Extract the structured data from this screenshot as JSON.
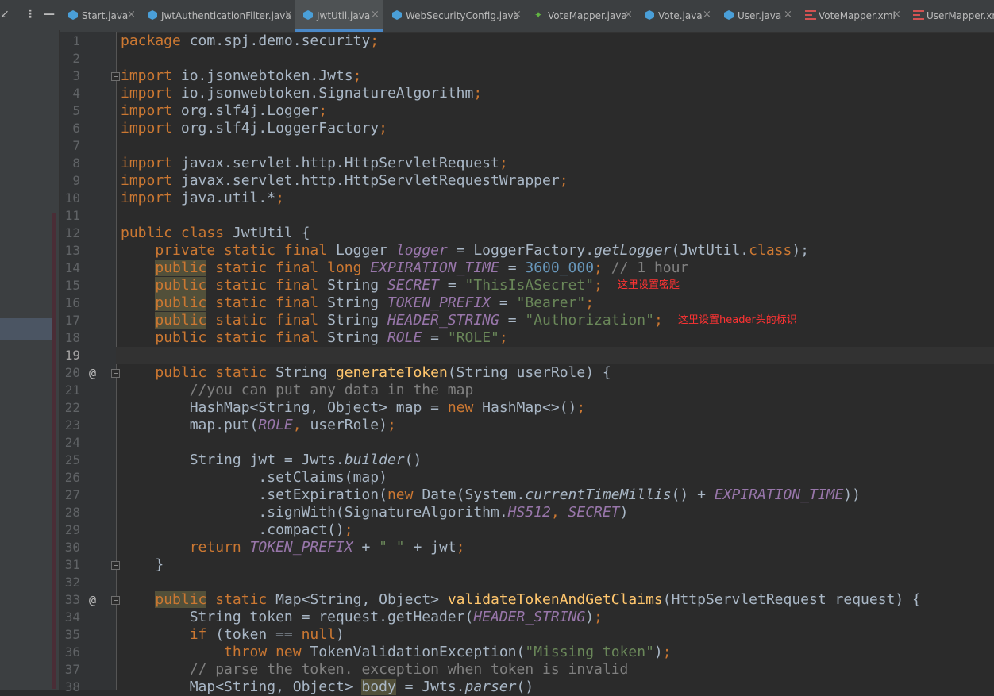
{
  "left_panel": {
    "collapse_icon": "collapse-arrows-icon",
    "menu_icon": "vertical-dots-icon",
    "hide_icon": "minimize-icon"
  },
  "tabs": [
    {
      "label": "Start.java",
      "icon": "java-class-icon",
      "active": false
    },
    {
      "label": "JwtAuthenticationFilter.java",
      "icon": "java-class-icon",
      "active": false
    },
    {
      "label": "JwtUtil.java",
      "icon": "java-class-icon",
      "active": true
    },
    {
      "label": "WebSecurityConfig.java",
      "icon": "java-class-icon",
      "active": false
    },
    {
      "label": "VoteMapper.java",
      "icon": "mapper-interface-icon",
      "active": false
    },
    {
      "label": "Vote.java",
      "icon": "java-class-icon",
      "active": false
    },
    {
      "label": "User.java",
      "icon": "java-class-icon",
      "active": false
    },
    {
      "label": "VoteMapper.xml",
      "icon": "xml-file-icon",
      "active": false
    },
    {
      "label": "UserMapper.xml",
      "icon": "xml-file-icon",
      "active": false
    }
  ],
  "tab_close_glyph": "×",
  "editor": {
    "current_line": 19,
    "lines": [
      {
        "n": 1,
        "tokens": [
          [
            "kw",
            "package "
          ],
          [
            "",
            "com.spj.demo.security"
          ],
          [
            "kw",
            ";"
          ]
        ]
      },
      {
        "n": 2,
        "tokens": []
      },
      {
        "n": 3,
        "tokens": [
          [
            "kw",
            "import "
          ],
          [
            "",
            "io.jsonwebtoken.Jwts"
          ],
          [
            "kw",
            ";"
          ]
        ]
      },
      {
        "n": 4,
        "tokens": [
          [
            "kw",
            "import "
          ],
          [
            "",
            "io.jsonwebtoken.SignatureAlgorithm"
          ],
          [
            "kw",
            ";"
          ]
        ]
      },
      {
        "n": 5,
        "tokens": [
          [
            "kw",
            "import "
          ],
          [
            "",
            "org.slf4j.Logger"
          ],
          [
            "kw",
            ";"
          ]
        ]
      },
      {
        "n": 6,
        "tokens": [
          [
            "kw",
            "import "
          ],
          [
            "",
            "org.slf4j.LoggerFactory"
          ],
          [
            "kw",
            ";"
          ]
        ]
      },
      {
        "n": 7,
        "tokens": []
      },
      {
        "n": 8,
        "tokens": [
          [
            "kw",
            "import "
          ],
          [
            "",
            "javax.servlet.http.HttpServletRequest"
          ],
          [
            "kw",
            ";"
          ]
        ]
      },
      {
        "n": 9,
        "tokens": [
          [
            "kw",
            "import "
          ],
          [
            "",
            "javax.servlet.http.HttpServletRequestWrapper"
          ],
          [
            "kw",
            ";"
          ]
        ]
      },
      {
        "n": 10,
        "tokens": [
          [
            "kw",
            "import "
          ],
          [
            "",
            "java.util.*"
          ],
          [
            "kw",
            ";"
          ]
        ]
      },
      {
        "n": 11,
        "tokens": []
      },
      {
        "n": 12,
        "tokens": [
          [
            "kw",
            "public class "
          ],
          [
            "",
            "JwtUtil {"
          ]
        ]
      },
      {
        "n": 13,
        "tokens": [
          [
            "",
            "    "
          ],
          [
            "kw",
            "private static final "
          ],
          [
            "",
            "Logger "
          ],
          [
            "ivar",
            "logger"
          ],
          [
            "",
            " = LoggerFactory."
          ],
          [
            "stc",
            "getLogger"
          ],
          [
            "",
            "(JwtUtil."
          ],
          [
            "kw",
            "class"
          ],
          [
            "",
            ");"
          ]
        ]
      },
      {
        "n": 14,
        "tokens": [
          [
            "",
            "    "
          ],
          [
            "kw hl",
            "public"
          ],
          [
            "kw",
            " static final long "
          ],
          [
            "ivar",
            "EXPIRATION_TIME"
          ],
          [
            "",
            " = "
          ],
          [
            "num",
            "3600_000"
          ],
          [
            "kw",
            ";"
          ],
          [
            "cmt",
            " // 1 hour"
          ]
        ]
      },
      {
        "n": 15,
        "tokens": [
          [
            "",
            "    "
          ],
          [
            "kw hl",
            "public"
          ],
          [
            "kw",
            " static final "
          ],
          [
            "",
            "String "
          ],
          [
            "ivar",
            "SECRET"
          ],
          [
            "",
            " = "
          ],
          [
            "str",
            "\"ThisIsASecret\""
          ],
          [
            "kw",
            ";"
          ]
        ]
      },
      {
        "n": 16,
        "tokens": [
          [
            "",
            "    "
          ],
          [
            "kw hl",
            "public"
          ],
          [
            "kw",
            " static final "
          ],
          [
            "",
            "String "
          ],
          [
            "ivar",
            "TOKEN_PREFIX"
          ],
          [
            "",
            " = "
          ],
          [
            "str",
            "\"Bearer\""
          ],
          [
            "kw",
            ";"
          ]
        ]
      },
      {
        "n": 17,
        "tokens": [
          [
            "",
            "    "
          ],
          [
            "kw hl",
            "public"
          ],
          [
            "kw",
            " static final "
          ],
          [
            "",
            "String "
          ],
          [
            "ivar",
            "HEADER_STRING"
          ],
          [
            "",
            " = "
          ],
          [
            "str",
            "\"Authorization\""
          ],
          [
            "kw",
            ";"
          ]
        ]
      },
      {
        "n": 18,
        "tokens": [
          [
            "",
            "    "
          ],
          [
            "kw",
            "public static final "
          ],
          [
            "",
            "String "
          ],
          [
            "ivar",
            "ROLE"
          ],
          [
            "",
            " = "
          ],
          [
            "str",
            "\"ROLE\""
          ],
          [
            "kw",
            ";"
          ]
        ]
      },
      {
        "n": 19,
        "tokens": []
      },
      {
        "n": 20,
        "tokens": [
          [
            "",
            "    "
          ],
          [
            "kw",
            "public static "
          ],
          [
            "",
            "String "
          ],
          [
            "fn",
            "generateToken"
          ],
          [
            "",
            "(String userRole) {"
          ]
        ]
      },
      {
        "n": 21,
        "tokens": [
          [
            "",
            "        "
          ],
          [
            "cmt",
            "//you can put any data in the map"
          ]
        ]
      },
      {
        "n": 22,
        "tokens": [
          [
            "",
            "        HashMap<String, Object> map = "
          ],
          [
            "kw",
            "new "
          ],
          [
            "",
            "HashMap<>()"
          ],
          [
            "kw",
            ";"
          ]
        ]
      },
      {
        "n": 23,
        "tokens": [
          [
            "",
            "        map.put("
          ],
          [
            "ivar",
            "ROLE"
          ],
          [
            "kw",
            ", "
          ],
          [
            "",
            "userRole)"
          ],
          [
            "kw",
            ";"
          ]
        ]
      },
      {
        "n": 24,
        "tokens": []
      },
      {
        "n": 25,
        "tokens": [
          [
            "",
            "        String jwt = Jwts."
          ],
          [
            "stc",
            "builder"
          ],
          [
            "",
            "()"
          ]
        ]
      },
      {
        "n": 26,
        "tokens": [
          [
            "",
            "                .setClaims(map)"
          ]
        ]
      },
      {
        "n": 27,
        "tokens": [
          [
            "",
            "                .setExpiration("
          ],
          [
            "kw",
            "new "
          ],
          [
            "",
            "Date(System."
          ],
          [
            "stc",
            "currentTimeMillis"
          ],
          [
            "",
            "() + "
          ],
          [
            "ivar",
            "EXPIRATION_TIME"
          ],
          [
            "",
            "))"
          ]
        ]
      },
      {
        "n": 28,
        "tokens": [
          [
            "",
            "                .signWith(SignatureAlgorithm."
          ],
          [
            "ivar",
            "HS512"
          ],
          [
            "kw",
            ", "
          ],
          [
            "ivar",
            "SECRET"
          ],
          [
            "",
            ")"
          ]
        ]
      },
      {
        "n": 29,
        "tokens": [
          [
            "",
            "                .compact()"
          ],
          [
            "kw",
            ";"
          ]
        ]
      },
      {
        "n": 30,
        "tokens": [
          [
            "",
            "        "
          ],
          [
            "kw",
            "return "
          ],
          [
            "ivar",
            "TOKEN_PREFIX"
          ],
          [
            "",
            " + "
          ],
          [
            "str",
            "\" \""
          ],
          [
            "",
            " + jwt"
          ],
          [
            "kw",
            ";"
          ]
        ]
      },
      {
        "n": 31,
        "tokens": [
          [
            "",
            "    }"
          ]
        ]
      },
      {
        "n": 32,
        "tokens": []
      },
      {
        "n": 33,
        "tokens": [
          [
            "",
            "    "
          ],
          [
            "kw hl",
            "public"
          ],
          [
            "kw",
            " static "
          ],
          [
            "",
            "Map<String, Object> "
          ],
          [
            "fn",
            "validateTokenAndGetClaims"
          ],
          [
            "",
            "(HttpServletRequest request) {"
          ]
        ]
      },
      {
        "n": 34,
        "tokens": [
          [
            "",
            "        String token = request.getHeader("
          ],
          [
            "ivar",
            "HEADER_STRING"
          ],
          [
            "",
            ")"
          ],
          [
            "kw",
            ";"
          ]
        ]
      },
      {
        "n": 35,
        "tokens": [
          [
            "",
            "        "
          ],
          [
            "kw",
            "if "
          ],
          [
            "",
            "(token == "
          ],
          [
            "kw",
            "null"
          ],
          [
            "",
            ")"
          ]
        ]
      },
      {
        "n": 36,
        "tokens": [
          [
            "",
            "            "
          ],
          [
            "kw",
            "throw new "
          ],
          [
            "",
            "TokenValidationException("
          ],
          [
            "str",
            "\"Missing token\""
          ],
          [
            "",
            ")"
          ],
          [
            "kw",
            ";"
          ]
        ]
      },
      {
        "n": 37,
        "tokens": [
          [
            "",
            "        "
          ],
          [
            "cmt",
            "// parse the token. exception when token is invalid"
          ]
        ]
      },
      {
        "n": 38,
        "tokens": [
          [
            "",
            "        Map<String, Object> "
          ],
          [
            "hl",
            "body"
          ],
          [
            "",
            " = Jwts."
          ],
          [
            "stc",
            "parser"
          ],
          [
            "",
            "()"
          ]
        ]
      }
    ],
    "gutter_marks": [
      {
        "line": 20,
        "glyph": "@"
      },
      {
        "line": 33,
        "glyph": "@"
      }
    ],
    "fold_markers": [
      3,
      20,
      31,
      33
    ],
    "annotations": [
      {
        "line": 15,
        "text": "这里设置密匙"
      },
      {
        "line": 17,
        "text": "这里设置header头的标识"
      }
    ]
  }
}
